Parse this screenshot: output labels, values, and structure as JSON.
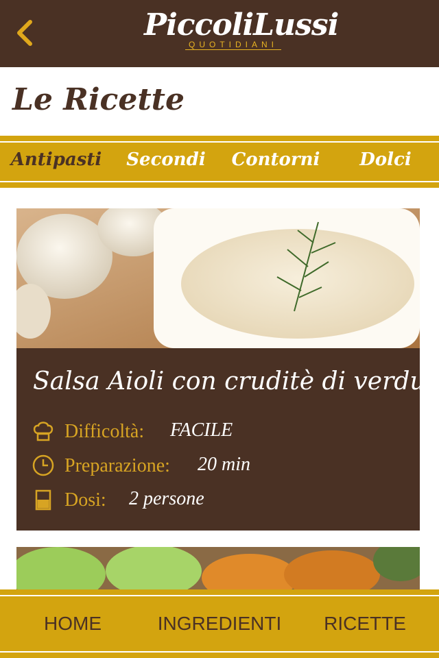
{
  "header": {
    "logo_main": "PiccoliLussi",
    "logo_sub": "QUOTIDIANI"
  },
  "page_title": "Le Ricette",
  "tabs": [
    {
      "label": "Antipasti",
      "active": true
    },
    {
      "label": "Secondi",
      "active": false
    },
    {
      "label": "Contorni",
      "active": false
    },
    {
      "label": "Dolci",
      "active": false
    }
  ],
  "recipe": {
    "title": "Salsa Aioli con cruditè di verdure",
    "difficulty_label": "Difficoltà:",
    "difficulty_value": "FACILE",
    "prep_label": "Preparazione:",
    "prep_value": "20 min",
    "doses_label": "Dosi:",
    "doses_value": "2 persone"
  },
  "bottom_nav": {
    "home": "HOME",
    "ingredients": "INGREDIENTI",
    "recipes": "RICETTE"
  },
  "colors": {
    "brown": "#4a3124",
    "gold": "#d3a40f",
    "accent": "#d7a423"
  }
}
